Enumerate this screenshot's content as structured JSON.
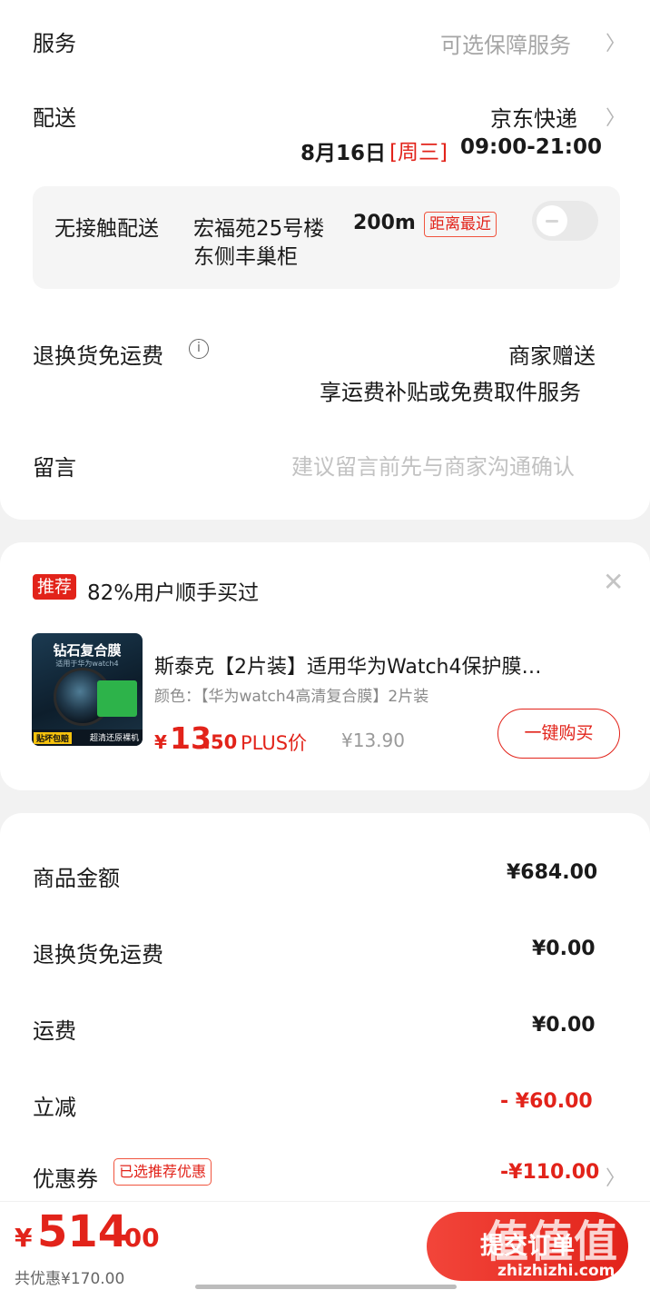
{
  "service": {
    "label": "服务",
    "value": "可选保障服务"
  },
  "delivery": {
    "label": "配送",
    "carrier": "京东快递",
    "date": "8月16日",
    "weekday": "[周三]",
    "time": "09:00-21:00"
  },
  "contactless": {
    "label": "无接触配送",
    "address_line1": "宏福苑25号楼",
    "distance": "200m",
    "badge": "距离最近",
    "address_line2": "东侧丰巢柜",
    "enabled": false
  },
  "return_shipping": {
    "label": "退换货免运费",
    "info_icon": "info-icon",
    "provider": "商家赠送",
    "description": "享运费补贴或免费取件服务"
  },
  "message": {
    "label": "留言",
    "placeholder": "建议留言前先与商家沟通确认"
  },
  "recommend": {
    "badge": "推荐",
    "headline": "82%用户顺手买过",
    "product": {
      "title": "斯泰克【2片装】适用华为Watch4保护膜…",
      "variant": "颜色：【华为watch4高清复合膜】2片装",
      "currency": "¥",
      "price_int": "13",
      "price_dec": ".50",
      "plus_label": "PLUS价",
      "orig_price": "¥13.90",
      "buy_label": "一键购买",
      "image": {
        "title": "钻石复合膜",
        "subtitle": "适用于华为watch4",
        "badge_left": "贴坏包赔",
        "badge_right": "超清还原裸机"
      }
    }
  },
  "summary": {
    "rows": [
      {
        "label": "商品金额",
        "value": "¥684.00"
      },
      {
        "label": "退换货免运费",
        "value": "¥0.00"
      },
      {
        "label": "运费",
        "value": "¥0.00"
      },
      {
        "label": "立减",
        "value": "- ¥60.00"
      }
    ],
    "coupon": {
      "label": "优惠券",
      "tag": "已选推荐优惠",
      "value": "-¥110.00"
    }
  },
  "footer": {
    "currency": "¥",
    "total_int": "514",
    "total_dec": ".00",
    "saved": "共优惠¥170.00",
    "submit_label": "提交订单",
    "watermark": "值值值",
    "watermark_url": "zhizhizhi.com"
  },
  "colors": {
    "accent": "#e2231a",
    "muted": "#a6a6a6",
    "background": "#f2f2f2"
  }
}
